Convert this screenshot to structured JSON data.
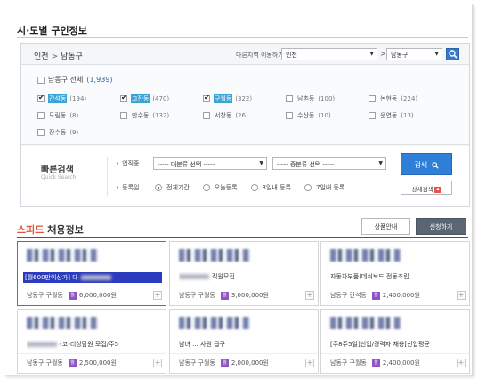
{
  "page_title": "시·도별 구인정보",
  "location": {
    "breadcrumb": [
      "인천",
      "남동구"
    ],
    "other_label": "다른지역 이동하기",
    "city_select": "인천",
    "district_select": "남동구"
  },
  "districts": {
    "all_label": "남동구 전체",
    "all_count": "(1,939)",
    "items": [
      {
        "name": "간석동",
        "count": "(194)",
        "checked": true
      },
      {
        "name": "고잔동",
        "count": "(470)",
        "checked": true
      },
      {
        "name": "구월동",
        "count": "(322)",
        "checked": true
      },
      {
        "name": "남촌동",
        "count": "(100)",
        "checked": false
      },
      {
        "name": "논현동",
        "count": "(224)",
        "checked": false
      },
      {
        "name": "도림동",
        "count": "(8)",
        "checked": false
      },
      {
        "name": "만수동",
        "count": "(132)",
        "checked": false
      },
      {
        "name": "서창동",
        "count": "(26)",
        "checked": false
      },
      {
        "name": "수산동",
        "count": "(10)",
        "checked": false
      },
      {
        "name": "운연동",
        "count": "(13)",
        "checked": false
      },
      {
        "name": "장수동",
        "count": "(9)",
        "checked": false
      }
    ]
  },
  "quick_search": {
    "title": "빠른검색",
    "subtitle": "Quick Search",
    "job_label": "업직종",
    "major_select": "----- 대분류 선택 -----",
    "minor_select": "----- 중분류 선택 -----",
    "reg_label": "등록일",
    "radios": [
      {
        "label": "전체기간",
        "selected": true
      },
      {
        "label": "오늘등록",
        "selected": false
      },
      {
        "label": "3일내 등록",
        "selected": false
      },
      {
        "label": "7일내 등록",
        "selected": false
      }
    ],
    "search_button": "검색",
    "detail_button": "상세검색"
  },
  "speed": {
    "title_a": "스피드",
    "title_b": " 채용정보",
    "product_button": "상품안내",
    "apply_button": "신청하기"
  },
  "jobs": [
    {
      "title": "[월600만이상가] 대",
      "location": "남동구 구월동",
      "pay": "6,000,000원",
      "highlight": true
    },
    {
      "title": "직원모집",
      "location": "남동구 구월동",
      "pay": "3,000,000원",
      "highlight": false
    },
    {
      "title": "자동차부품(데쉬보드 전동조립",
      "location": "남동구 간석동",
      "pay": "2,400,000원",
      "highlight": false
    },
    {
      "title": "(코)리상담원 모집/주5",
      "location": "남동구 구월동",
      "pay": "2,500,000원",
      "highlight": false
    },
    {
      "title": "남녀 ... 사원 급구",
      "location": "남동구 구월동",
      "pay": "2,000,000원",
      "highlight": false
    },
    {
      "title": "[주8주5일]신입/경력자 채용[신입평균",
      "location": "남동구 구월동",
      "pay": "2,400,000원",
      "highlight": false
    }
  ],
  "colors": {
    "accent_blue": "#2f7fd8",
    "selected_district": "#3aa4d8",
    "speed_red": "#e0533e",
    "pay_badge": "#8f55c2",
    "highlight_bar": "#2b3bbd"
  }
}
